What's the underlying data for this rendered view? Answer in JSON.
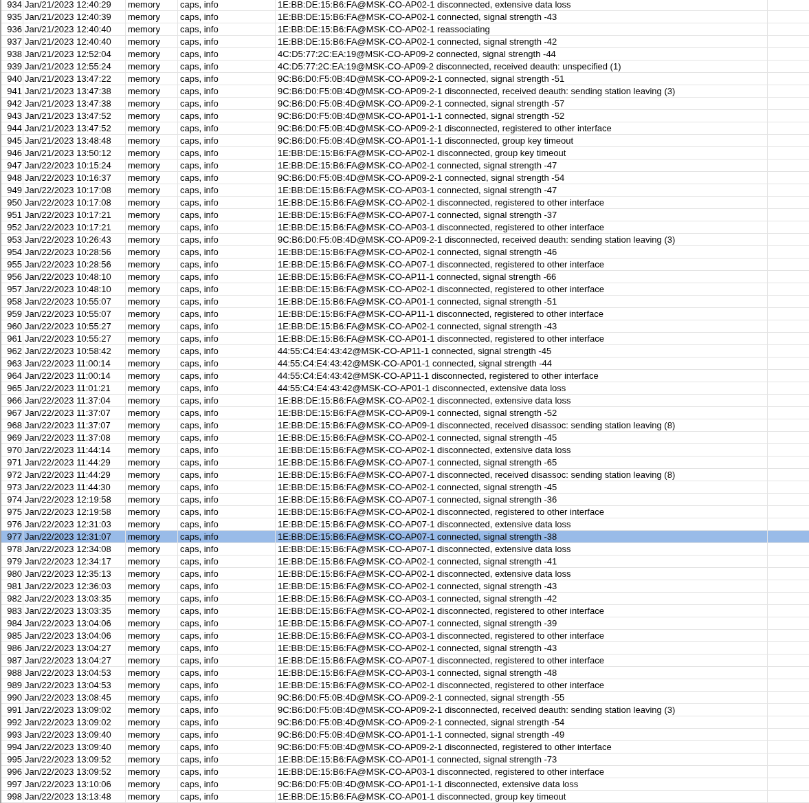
{
  "log_table": {
    "rows": [
      {
        "cells": [
          "934",
          "Jan/21/2023 12:40:29",
          "memory",
          "caps, info",
          "1E:BB:DE:15:B6:FA@MSK-CO-AP02-1 disconnected, extensive data loss"
        ],
        "selected": false
      },
      {
        "cells": [
          "935",
          "Jan/21/2023 12:40:39",
          "memory",
          "caps, info",
          "1E:BB:DE:15:B6:FA@MSK-CO-AP02-1 connected, signal strength -43"
        ],
        "selected": false
      },
      {
        "cells": [
          "936",
          "Jan/21/2023 12:40:40",
          "memory",
          "caps, info",
          "1E:BB:DE:15:B6:FA@MSK-CO-AP02-1 reassociating"
        ],
        "selected": false
      },
      {
        "cells": [
          "937",
          "Jan/21/2023 12:40:40",
          "memory",
          "caps, info",
          "1E:BB:DE:15:B6:FA@MSK-CO-AP02-1 connected, signal strength -42"
        ],
        "selected": false
      },
      {
        "cells": [
          "938",
          "Jan/21/2023 12:52:04",
          "memory",
          "caps, info",
          "4C:D5:77:2C:EA:19@MSK-CO-AP09-2 connected, signal strength -44"
        ],
        "selected": false
      },
      {
        "cells": [
          "939",
          "Jan/21/2023 12:55:24",
          "memory",
          "caps, info",
          "4C:D5:77:2C:EA:19@MSK-CO-AP09-2 disconnected, received deauth: unspecified (1)"
        ],
        "selected": false
      },
      {
        "cells": [
          "940",
          "Jan/21/2023 13:47:22",
          "memory",
          "caps, info",
          "9C:B6:D0:F5:0B:4D@MSK-CO-AP09-2-1 connected, signal strength -51"
        ],
        "selected": false
      },
      {
        "cells": [
          "941",
          "Jan/21/2023 13:47:38",
          "memory",
          "caps, info",
          "9C:B6:D0:F5:0B:4D@MSK-CO-AP09-2-1 disconnected, received deauth: sending station leaving (3)"
        ],
        "selected": false
      },
      {
        "cells": [
          "942",
          "Jan/21/2023 13:47:38",
          "memory",
          "caps, info",
          "9C:B6:D0:F5:0B:4D@MSK-CO-AP09-2-1 connected, signal strength -57"
        ],
        "selected": false
      },
      {
        "cells": [
          "943",
          "Jan/21/2023 13:47:52",
          "memory",
          "caps, info",
          "9C:B6:D0:F5:0B:4D@MSK-CO-AP01-1-1 connected, signal strength -52"
        ],
        "selected": false
      },
      {
        "cells": [
          "944",
          "Jan/21/2023 13:47:52",
          "memory",
          "caps, info",
          "9C:B6:D0:F5:0B:4D@MSK-CO-AP09-2-1 disconnected, registered to other interface"
        ],
        "selected": false
      },
      {
        "cells": [
          "945",
          "Jan/21/2023 13:48:48",
          "memory",
          "caps, info",
          "9C:B6:D0:F5:0B:4D@MSK-CO-AP01-1-1 disconnected, group key timeout"
        ],
        "selected": false
      },
      {
        "cells": [
          "946",
          "Jan/21/2023 13:50:12",
          "memory",
          "caps, info",
          "1E:BB:DE:15:B6:FA@MSK-CO-AP02-1 disconnected, group key timeout"
        ],
        "selected": false
      },
      {
        "cells": [
          "947",
          "Jan/22/2023 10:15:24",
          "memory",
          "caps, info",
          "1E:BB:DE:15:B6:FA@MSK-CO-AP02-1 connected, signal strength -47"
        ],
        "selected": false
      },
      {
        "cells": [
          "948",
          "Jan/22/2023 10:16:37",
          "memory",
          "caps, info",
          "9C:B6:D0:F5:0B:4D@MSK-CO-AP09-2-1 connected, signal strength -54"
        ],
        "selected": false
      },
      {
        "cells": [
          "949",
          "Jan/22/2023 10:17:08",
          "memory",
          "caps, info",
          "1E:BB:DE:15:B6:FA@MSK-CO-AP03-1 connected, signal strength -47"
        ],
        "selected": false
      },
      {
        "cells": [
          "950",
          "Jan/22/2023 10:17:08",
          "memory",
          "caps, info",
          "1E:BB:DE:15:B6:FA@MSK-CO-AP02-1 disconnected, registered to other interface"
        ],
        "selected": false
      },
      {
        "cells": [
          "951",
          "Jan/22/2023 10:17:21",
          "memory",
          "caps, info",
          "1E:BB:DE:15:B6:FA@MSK-CO-AP07-1 connected, signal strength -37"
        ],
        "selected": false
      },
      {
        "cells": [
          "952",
          "Jan/22/2023 10:17:21",
          "memory",
          "caps, info",
          "1E:BB:DE:15:B6:FA@MSK-CO-AP03-1 disconnected, registered to other interface"
        ],
        "selected": false
      },
      {
        "cells": [
          "953",
          "Jan/22/2023 10:26:43",
          "memory",
          "caps, info",
          "9C:B6:D0:F5:0B:4D@MSK-CO-AP09-2-1 disconnected, received deauth: sending station leaving (3)"
        ],
        "selected": false
      },
      {
        "cells": [
          "954",
          "Jan/22/2023 10:28:56",
          "memory",
          "caps, info",
          "1E:BB:DE:15:B6:FA@MSK-CO-AP02-1 connected, signal strength -46"
        ],
        "selected": false
      },
      {
        "cells": [
          "955",
          "Jan/22/2023 10:28:56",
          "memory",
          "caps, info",
          "1E:BB:DE:15:B6:FA@MSK-CO-AP07-1 disconnected, registered to other interface"
        ],
        "selected": false
      },
      {
        "cells": [
          "956",
          "Jan/22/2023 10:48:10",
          "memory",
          "caps, info",
          "1E:BB:DE:15:B6:FA@MSK-CO-AP11-1 connected, signal strength -66"
        ],
        "selected": false
      },
      {
        "cells": [
          "957",
          "Jan/22/2023 10:48:10",
          "memory",
          "caps, info",
          "1E:BB:DE:15:B6:FA@MSK-CO-AP02-1 disconnected, registered to other interface"
        ],
        "selected": false
      },
      {
        "cells": [
          "958",
          "Jan/22/2023 10:55:07",
          "memory",
          "caps, info",
          "1E:BB:DE:15:B6:FA@MSK-CO-AP01-1 connected, signal strength -51"
        ],
        "selected": false
      },
      {
        "cells": [
          "959",
          "Jan/22/2023 10:55:07",
          "memory",
          "caps, info",
          "1E:BB:DE:15:B6:FA@MSK-CO-AP11-1 disconnected, registered to other interface"
        ],
        "selected": false
      },
      {
        "cells": [
          "960",
          "Jan/22/2023 10:55:27",
          "memory",
          "caps, info",
          "1E:BB:DE:15:B6:FA@MSK-CO-AP02-1 connected, signal strength -43"
        ],
        "selected": false
      },
      {
        "cells": [
          "961",
          "Jan/22/2023 10:55:27",
          "memory",
          "caps, info",
          "1E:BB:DE:15:B6:FA@MSK-CO-AP01-1 disconnected, registered to other interface"
        ],
        "selected": false
      },
      {
        "cells": [
          "962",
          "Jan/22/2023 10:58:42",
          "memory",
          "caps, info",
          "44:55:C4:E4:43:42@MSK-CO-AP11-1 connected, signal strength -45"
        ],
        "selected": false
      },
      {
        "cells": [
          "963",
          "Jan/22/2023 11:00:14",
          "memory",
          "caps, info",
          "44:55:C4:E4:43:42@MSK-CO-AP01-1 connected, signal strength -44"
        ],
        "selected": false
      },
      {
        "cells": [
          "964",
          "Jan/22/2023 11:00:14",
          "memory",
          "caps, info",
          "44:55:C4:E4:43:42@MSK-CO-AP11-1 disconnected, registered to other interface"
        ],
        "selected": false
      },
      {
        "cells": [
          "965",
          "Jan/22/2023 11:01:21",
          "memory",
          "caps, info",
          "44:55:C4:E4:43:42@MSK-CO-AP01-1 disconnected, extensive data loss"
        ],
        "selected": false
      },
      {
        "cells": [
          "966",
          "Jan/22/2023 11:37:04",
          "memory",
          "caps, info",
          "1E:BB:DE:15:B6:FA@MSK-CO-AP02-1 disconnected, extensive data loss"
        ],
        "selected": false
      },
      {
        "cells": [
          "967",
          "Jan/22/2023 11:37:07",
          "memory",
          "caps, info",
          "1E:BB:DE:15:B6:FA@MSK-CO-AP09-1 connected, signal strength -52"
        ],
        "selected": false
      },
      {
        "cells": [
          "968",
          "Jan/22/2023 11:37:07",
          "memory",
          "caps, info",
          "1E:BB:DE:15:B6:FA@MSK-CO-AP09-1 disconnected, received disassoc: sending station leaving (8)"
        ],
        "selected": false
      },
      {
        "cells": [
          "969",
          "Jan/22/2023 11:37:08",
          "memory",
          "caps, info",
          "1E:BB:DE:15:B6:FA@MSK-CO-AP02-1 connected, signal strength -45"
        ],
        "selected": false
      },
      {
        "cells": [
          "970",
          "Jan/22/2023 11:44:14",
          "memory",
          "caps, info",
          "1E:BB:DE:15:B6:FA@MSK-CO-AP02-1 disconnected, extensive data loss"
        ],
        "selected": false
      },
      {
        "cells": [
          "971",
          "Jan/22/2023 11:44:29",
          "memory",
          "caps, info",
          "1E:BB:DE:15:B6:FA@MSK-CO-AP07-1 connected, signal strength -65"
        ],
        "selected": false
      },
      {
        "cells": [
          "972",
          "Jan/22/2023 11:44:29",
          "memory",
          "caps, info",
          "1E:BB:DE:15:B6:FA@MSK-CO-AP07-1 disconnected, received disassoc: sending station leaving (8)"
        ],
        "selected": false
      },
      {
        "cells": [
          "973",
          "Jan/22/2023 11:44:30",
          "memory",
          "caps, info",
          "1E:BB:DE:15:B6:FA@MSK-CO-AP02-1 connected, signal strength -45"
        ],
        "selected": false
      },
      {
        "cells": [
          "974",
          "Jan/22/2023 12:19:58",
          "memory",
          "caps, info",
          "1E:BB:DE:15:B6:FA@MSK-CO-AP07-1 connected, signal strength -36"
        ],
        "selected": false
      },
      {
        "cells": [
          "975",
          "Jan/22/2023 12:19:58",
          "memory",
          "caps, info",
          "1E:BB:DE:15:B6:FA@MSK-CO-AP02-1 disconnected, registered to other interface"
        ],
        "selected": false
      },
      {
        "cells": [
          "976",
          "Jan/22/2023 12:31:03",
          "memory",
          "caps, info",
          "1E:BB:DE:15:B6:FA@MSK-CO-AP07-1 disconnected, extensive data loss"
        ],
        "selected": false
      },
      {
        "cells": [
          "977",
          "Jan/22/2023 12:31:07",
          "memory",
          "caps, info",
          "1E:BB:DE:15:B6:FA@MSK-CO-AP07-1 connected, signal strength -38"
        ],
        "selected": true
      },
      {
        "cells": [
          "978",
          "Jan/22/2023 12:34:08",
          "memory",
          "caps, info",
          "1E:BB:DE:15:B6:FA@MSK-CO-AP07-1 disconnected, extensive data loss"
        ],
        "selected": false
      },
      {
        "cells": [
          "979",
          "Jan/22/2023 12:34:17",
          "memory",
          "caps, info",
          "1E:BB:DE:15:B6:FA@MSK-CO-AP02-1 connected, signal strength -41"
        ],
        "selected": false
      },
      {
        "cells": [
          "980",
          "Jan/22/2023 12:35:13",
          "memory",
          "caps, info",
          "1E:BB:DE:15:B6:FA@MSK-CO-AP02-1 disconnected, extensive data loss"
        ],
        "selected": false
      },
      {
        "cells": [
          "981",
          "Jan/22/2023 12:36:03",
          "memory",
          "caps, info",
          "1E:BB:DE:15:B6:FA@MSK-CO-AP02-1 connected, signal strength -43"
        ],
        "selected": false
      },
      {
        "cells": [
          "982",
          "Jan/22/2023 13:03:35",
          "memory",
          "caps, info",
          "1E:BB:DE:15:B6:FA@MSK-CO-AP03-1 connected, signal strength -42"
        ],
        "selected": false
      },
      {
        "cells": [
          "983",
          "Jan/22/2023 13:03:35",
          "memory",
          "caps, info",
          "1E:BB:DE:15:B6:FA@MSK-CO-AP02-1 disconnected, registered to other interface"
        ],
        "selected": false
      },
      {
        "cells": [
          "984",
          "Jan/22/2023 13:04:06",
          "memory",
          "caps, info",
          "1E:BB:DE:15:B6:FA@MSK-CO-AP07-1 connected, signal strength -39"
        ],
        "selected": false
      },
      {
        "cells": [
          "985",
          "Jan/22/2023 13:04:06",
          "memory",
          "caps, info",
          "1E:BB:DE:15:B6:FA@MSK-CO-AP03-1 disconnected, registered to other interface"
        ],
        "selected": false
      },
      {
        "cells": [
          "986",
          "Jan/22/2023 13:04:27",
          "memory",
          "caps, info",
          "1E:BB:DE:15:B6:FA@MSK-CO-AP02-1 connected, signal strength -43"
        ],
        "selected": false
      },
      {
        "cells": [
          "987",
          "Jan/22/2023 13:04:27",
          "memory",
          "caps, info",
          "1E:BB:DE:15:B6:FA@MSK-CO-AP07-1 disconnected, registered to other interface"
        ],
        "selected": false
      },
      {
        "cells": [
          "988",
          "Jan/22/2023 13:04:53",
          "memory",
          "caps, info",
          "1E:BB:DE:15:B6:FA@MSK-CO-AP03-1 connected, signal strength -48"
        ],
        "selected": false
      },
      {
        "cells": [
          "989",
          "Jan/22/2023 13:04:53",
          "memory",
          "caps, info",
          "1E:BB:DE:15:B6:FA@MSK-CO-AP02-1 disconnected, registered to other interface"
        ],
        "selected": false
      },
      {
        "cells": [
          "990",
          "Jan/22/2023 13:08:45",
          "memory",
          "caps, info",
          "9C:B6:D0:F5:0B:4D@MSK-CO-AP09-2-1 connected, signal strength -55"
        ],
        "selected": false
      },
      {
        "cells": [
          "991",
          "Jan/22/2023 13:09:02",
          "memory",
          "caps, info",
          "9C:B6:D0:F5:0B:4D@MSK-CO-AP09-2-1 disconnected, received deauth: sending station leaving (3)"
        ],
        "selected": false
      },
      {
        "cells": [
          "992",
          "Jan/22/2023 13:09:02",
          "memory",
          "caps, info",
          "9C:B6:D0:F5:0B:4D@MSK-CO-AP09-2-1 connected, signal strength -54"
        ],
        "selected": false
      },
      {
        "cells": [
          "993",
          "Jan/22/2023 13:09:40",
          "memory",
          "caps, info",
          "9C:B6:D0:F5:0B:4D@MSK-CO-AP01-1-1 connected, signal strength -49"
        ],
        "selected": false
      },
      {
        "cells": [
          "994",
          "Jan/22/2023 13:09:40",
          "memory",
          "caps, info",
          "9C:B6:D0:F5:0B:4D@MSK-CO-AP09-2-1 disconnected, registered to other interface"
        ],
        "selected": false
      },
      {
        "cells": [
          "995",
          "Jan/22/2023 13:09:52",
          "memory",
          "caps, info",
          "1E:BB:DE:15:B6:FA@MSK-CO-AP01-1 connected, signal strength -73"
        ],
        "selected": false
      },
      {
        "cells": [
          "996",
          "Jan/22/2023 13:09:52",
          "memory",
          "caps, info",
          "1E:BB:DE:15:B6:FA@MSK-CO-AP03-1 disconnected, registered to other interface"
        ],
        "selected": false
      },
      {
        "cells": [
          "997",
          "Jan/22/2023 13:10:06",
          "memory",
          "caps, info",
          "9C:B6:D0:F5:0B:4D@MSK-CO-AP01-1-1 disconnected, extensive data loss"
        ],
        "selected": false
      },
      {
        "cells": [
          "998",
          "Jan/22/2023 13:13:48",
          "memory",
          "caps, info",
          "1E:BB:DE:15:B6:FA@MSK-CO-AP01-1 disconnected, group key timeout"
        ],
        "selected": false
      }
    ]
  }
}
